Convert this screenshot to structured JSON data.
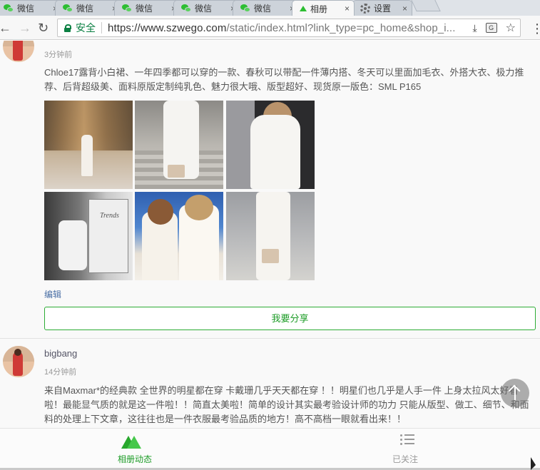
{
  "browser": {
    "tabs": [
      {
        "title": "微信",
        "icon": "wechat-icon"
      },
      {
        "title": "微信",
        "icon": "wechat-icon"
      },
      {
        "title": "微信",
        "icon": "wechat-icon"
      },
      {
        "title": "微信",
        "icon": "wechat-icon"
      },
      {
        "title": "微信",
        "icon": "wechat-icon"
      },
      {
        "title": "相册",
        "icon": "album-icon",
        "active": true
      },
      {
        "title": "设置",
        "icon": "gear-icon"
      }
    ],
    "tab_close": "×",
    "back": "←",
    "forward": "→",
    "reload": "↻",
    "secure_label": "安全",
    "url_main": "https://www.szwego.com",
    "url_rest": "/static/index.html?link_type=pc_home&shop_i...",
    "download_icon": "⤓",
    "translate_icon": "G",
    "star_icon": "☆",
    "menu_icon": "⋮"
  },
  "feed": {
    "post1": {
      "time": "3分钟前",
      "text": "Chloe17露背小白裙、一年四季都可以穿的一款、春秋可以带配一件薄内搭、冬天可以里面加毛衣、外搭大衣、极力推荐、后背超级美、面料原版定制纯乳色、魅力很大哦、版型超好、现货原一版色：SML P165",
      "photo4_caption": "Trends",
      "edit_label": "编辑",
      "share_label": "我要分享"
    },
    "post2": {
      "username": "bigbang",
      "time": "14分钟前",
      "text": "来自Maxmar*的经典款 全世界的明星都在穿 卡戴珊几乎天天都在穿 ！！明星们也几乎是人手一件 上身太拉风太好看啦！最能显气质的就是这一件啦！！简直太美啦！简单的设计其实最考验设计师的功力 只能从版型、做工、细节、和面料的处理上下文章，这往往也是一件衣服最考验品质的地方！高不高档一眼就看出来！！"
    }
  },
  "bottom_nav": {
    "album": "相册动态",
    "following": "已关注"
  },
  "colors": {
    "accent_green": "#2dac35",
    "secure_green": "#0b8043",
    "link_blue": "#4a6fa5"
  }
}
